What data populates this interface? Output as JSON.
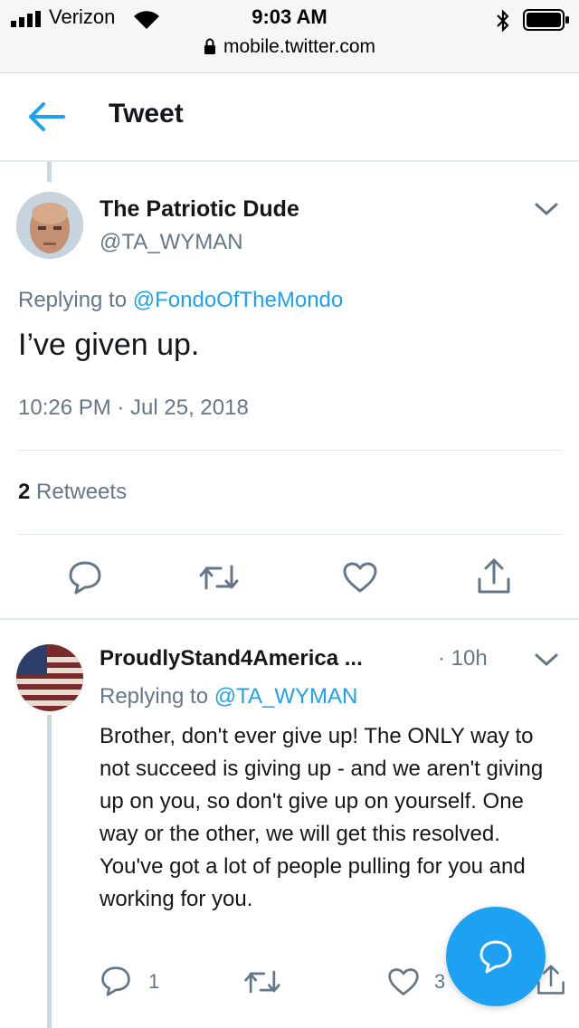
{
  "status_bar": {
    "carrier": "Verizon",
    "time": "9:03 AM",
    "url": "mobile.twitter.com"
  },
  "header": {
    "title": "Tweet"
  },
  "main_tweet": {
    "author_name": "The Patriotic Dude",
    "author_handle": "@TA_WYMAN",
    "replying_prefix": "Replying to ",
    "replying_to": "@FondoOfTheMondo",
    "text": "I’ve given up.",
    "timestamp": "10:26 PM · Jul 25, 2018",
    "retweet_count": "2",
    "retweet_label": "Retweets"
  },
  "reply_tweet": {
    "author_name": "ProudlyStand4America ...",
    "time_ago": "· 10h",
    "replying_prefix": "Replying to ",
    "replying_to": "@TA_WYMAN",
    "text": "Brother, don't ever give up!  The ONLY way to not succeed is giving up - and we aren't giving up on you, so don't give up on yourself.  One way or the other, we will get this resolved.  You've got a lot of people pulling for you and working for you.",
    "reply_count": "1",
    "like_count": "3"
  },
  "colors": {
    "accent": "#1da1f2",
    "secondary_text": "#657786",
    "icon": "#657786",
    "divider": "#e1e8ed"
  },
  "icons": [
    "signal-icon",
    "wifi-icon",
    "bluetooth-icon",
    "battery-icon",
    "lock-icon",
    "back-arrow-icon",
    "chevron-down-icon",
    "reply-icon",
    "retweet-icon",
    "like-icon",
    "share-icon",
    "compose-reply-icon"
  ]
}
